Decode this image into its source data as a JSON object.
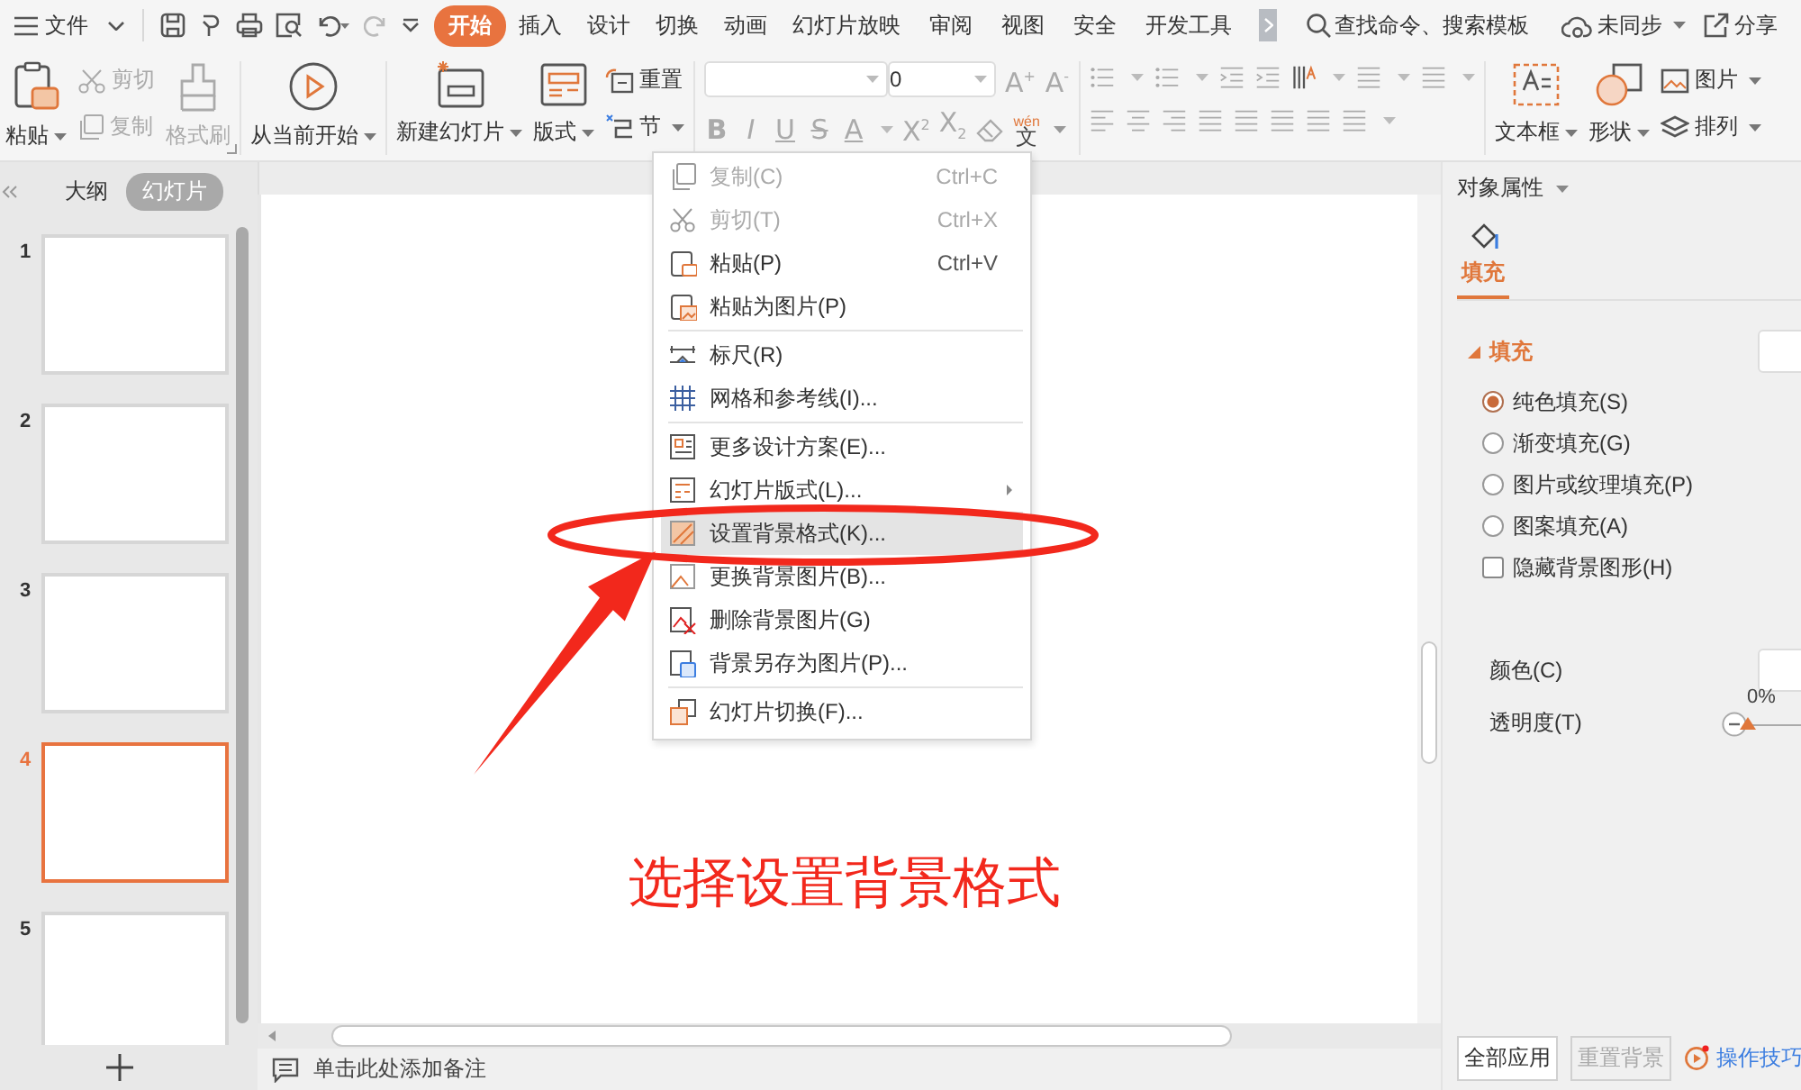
{
  "menu_bar": {
    "file_label": "文件",
    "tabs": [
      {
        "label": "开始",
        "selected": true
      },
      {
        "label": "插入",
        "selected": false
      },
      {
        "label": "设计",
        "selected": false
      },
      {
        "label": "切换",
        "selected": false
      },
      {
        "label": "动画",
        "selected": false
      },
      {
        "label": "幻灯片放映",
        "selected": false
      },
      {
        "label": "审阅",
        "selected": false
      },
      {
        "label": "视图",
        "selected": false
      },
      {
        "label": "安全",
        "selected": false
      },
      {
        "label": "开发工具",
        "selected": false
      }
    ],
    "search_placeholder": "查找命令、搜索模板",
    "sync_label": "未同步",
    "share_label": "分享"
  },
  "ribbon": {
    "paste": "粘贴",
    "cut": {
      "label": "剪切",
      "disabled": true
    },
    "copy": {
      "label": "复制",
      "disabled": true
    },
    "format_painter": {
      "label": "格式刷",
      "disabled": true
    },
    "from_current": "从当前开始",
    "new_slide": "新建幻灯片",
    "layout": "版式",
    "reset": "重置",
    "section": "节",
    "font_controls": {
      "disabled": true,
      "size": "0",
      "buttons": [
        "A$^{+}$",
        "A$^{-}$",
        "B",
        "I",
        "U",
        "S",
        "A",
        "X$^{2}$",
        "X$_{2}$"
      ],
      "phonetic_ruby": "wén",
      "phonetic_char": "文"
    },
    "insert": [
      "文本框",
      "形状",
      "图片",
      "排列"
    ]
  },
  "slides_panel": {
    "tabs": [
      {
        "label": "大纲",
        "selected": false
      },
      {
        "label": "幻灯片",
        "selected": true
      }
    ],
    "slides": [
      {
        "number": "1",
        "selected": false
      },
      {
        "number": "2",
        "selected": false
      },
      {
        "number": "3",
        "selected": false
      },
      {
        "number": "4",
        "selected": true
      },
      {
        "number": "5",
        "selected": false
      }
    ]
  },
  "editor": {
    "annotation": "选择设置背景格式",
    "notes_placeholder": "单击此处添加备注"
  },
  "context_menu": {
    "groups": [
      [
        {
          "label": "复制(C)",
          "shortcut": "Ctrl+C",
          "disabled": true,
          "selected": false,
          "submenu": false
        },
        {
          "label": "剪切(T)",
          "shortcut": "Ctrl+X",
          "disabled": true,
          "selected": false,
          "submenu": false
        },
        {
          "label": "粘贴(P)",
          "shortcut": "Ctrl+V",
          "disabled": false,
          "selected": false,
          "submenu": false
        },
        {
          "label": "粘贴为图片(P)",
          "disabled": false,
          "selected": false,
          "submenu": false
        }
      ],
      [
        {
          "label": "标尺(R)",
          "disabled": false,
          "selected": false,
          "submenu": false
        },
        {
          "label": "网格和参考线(I)...",
          "disabled": false,
          "selected": false,
          "submenu": false
        }
      ],
      [
        {
          "label": "更多设计方案(E)...",
          "disabled": false,
          "selected": false,
          "submenu": false
        },
        {
          "label": "幻灯片版式(L)...",
          "disabled": false,
          "selected": false,
          "submenu": true
        },
        {
          "label": "设置背景格式(K)...",
          "disabled": false,
          "selected": true,
          "submenu": false
        },
        {
          "label": "更换背景图片(B)...",
          "disabled": false,
          "selected": false,
          "submenu": false
        },
        {
          "label": "删除背景图片(G)",
          "disabled": false,
          "selected": false,
          "submenu": false
        },
        {
          "label": "背景另存为图片(P)...",
          "disabled": false,
          "selected": false,
          "submenu": false
        }
      ],
      [
        {
          "label": "幻灯片切换(F)...",
          "disabled": false,
          "selected": false,
          "submenu": false
        }
      ]
    ]
  },
  "properties_panel": {
    "title": "对象属性",
    "tab": {
      "label": "填充",
      "selected": true
    },
    "section": {
      "label": "填充",
      "expanded": true
    },
    "fill_options": [
      {
        "label": "纯色填充(S)",
        "selected": true
      },
      {
        "label": "渐变填充(G)",
        "selected": false
      },
      {
        "label": "图片或纹理填充(P)",
        "selected": false
      },
      {
        "label": "图案填充(A)",
        "selected": false
      }
    ],
    "hide_background": {
      "label": "隐藏背景图形(H)",
      "checked": false
    },
    "color_label": "颜色(C)",
    "transparency": {
      "label": "透明度(T)",
      "reading": "0%",
      "level": 0
    },
    "buttons": [
      {
        "label": "全部应用",
        "disabled": false
      },
      {
        "label": "重置背景",
        "disabled": true
      }
    ],
    "tips_link": "操作技巧"
  }
}
